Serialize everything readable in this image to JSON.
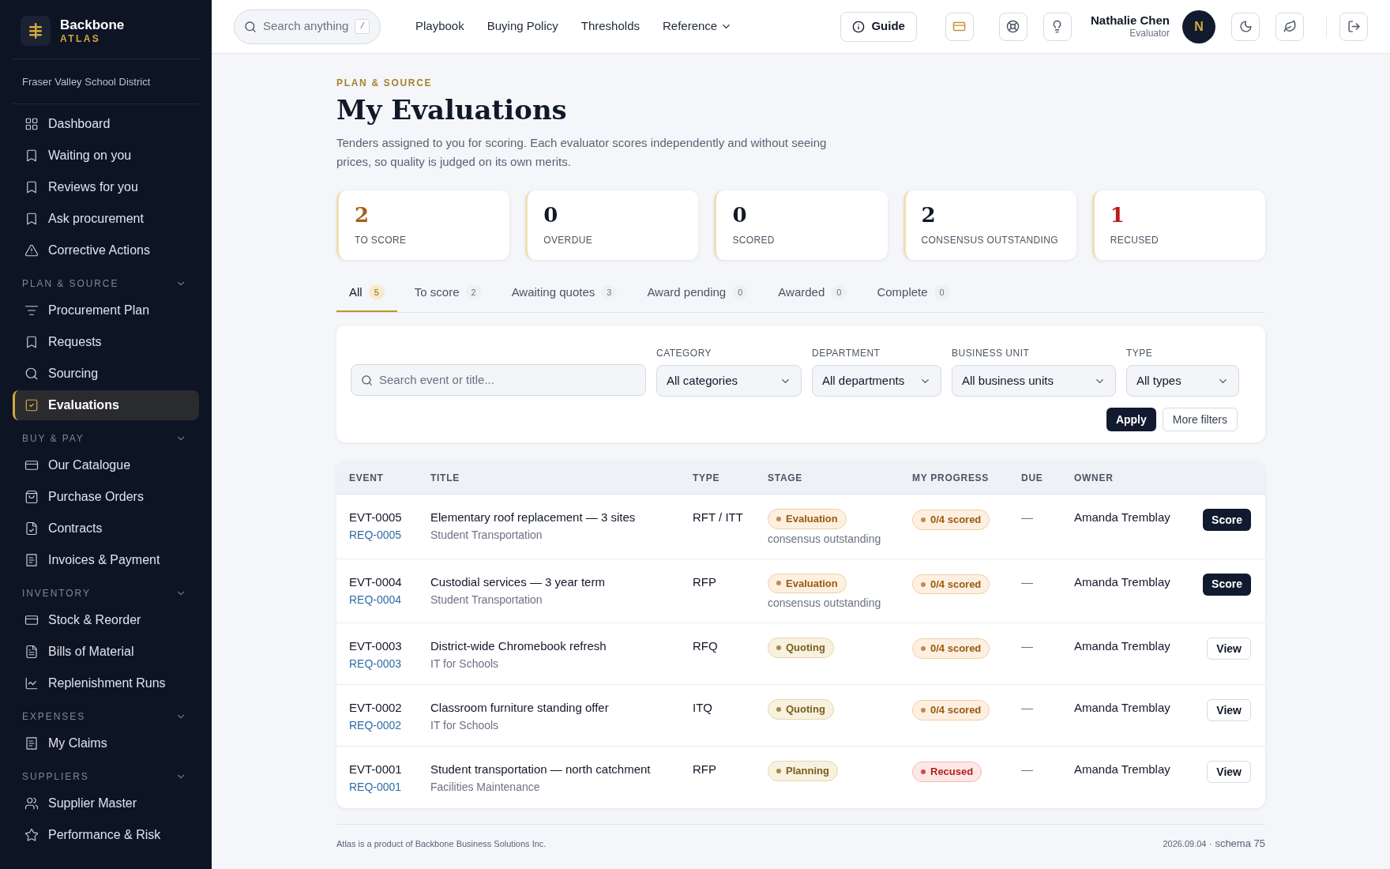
{
  "brand": {
    "name": "Backbone",
    "sub": "ATLAS",
    "org": "Fraser Valley School District"
  },
  "sidebar": {
    "items": [
      {
        "label": "Dashboard",
        "selected": false
      },
      {
        "label": "Waiting on you",
        "selected": false
      },
      {
        "label": "Reviews for you",
        "selected": false
      },
      {
        "label": "Ask procurement",
        "selected": false
      },
      {
        "label": "Corrective Actions",
        "selected": false
      }
    ],
    "sections": [
      {
        "title": "PLAN & SOURCE",
        "expanded": true,
        "items": [
          {
            "label": "Procurement Plan",
            "selected": false
          },
          {
            "label": "Requests",
            "selected": false
          },
          {
            "label": "Sourcing",
            "selected": false
          },
          {
            "label": "Evaluations",
            "selected": true
          }
        ]
      },
      {
        "title": "BUY & PAY",
        "expanded": true,
        "items": [
          {
            "label": "Our Catalogue",
            "selected": false
          },
          {
            "label": "Purchase Orders",
            "selected": false
          },
          {
            "label": "Contracts",
            "selected": false
          },
          {
            "label": "Invoices & Payment",
            "selected": false
          }
        ]
      },
      {
        "title": "INVENTORY",
        "expanded": true,
        "items": [
          {
            "label": "Stock & Reorder",
            "selected": false
          },
          {
            "label": "Bills of Material",
            "selected": false
          },
          {
            "label": "Replenishment Runs",
            "selected": false
          }
        ]
      },
      {
        "title": "EXPENSES",
        "expanded": true,
        "items": [
          {
            "label": "My Claims",
            "selected": false
          }
        ]
      },
      {
        "title": "SUPPLIERS",
        "expanded": true,
        "items": [
          {
            "label": "Supplier Master",
            "selected": false
          },
          {
            "label": "Performance & Risk",
            "selected": false
          }
        ]
      }
    ]
  },
  "topbar": {
    "search": {
      "placeholder": "Search anything",
      "shortcut": "/"
    },
    "links": [
      {
        "label": "Playbook",
        "has_menu": false
      },
      {
        "label": "Buying Policy",
        "has_menu": false
      },
      {
        "label": "Thresholds",
        "has_menu": false
      },
      {
        "label": "Reference",
        "has_menu": true
      }
    ],
    "guide": "Guide",
    "user": {
      "name": "Nathalie Chen",
      "role": "Evaluator",
      "initial": "N"
    }
  },
  "page": {
    "eyebrow": "PLAN & SOURCE",
    "title": "My Evaluations",
    "description": "Tenders assigned to you for scoring. Each evaluator scores independently and without seeing prices, so quality is judged on its own merits."
  },
  "stats": [
    {
      "value": "2",
      "label": "TO SCORE",
      "color": "#a85d1a"
    },
    {
      "value": "0",
      "label": "OVERDUE",
      "color": "#111827"
    },
    {
      "value": "0",
      "label": "SCORED",
      "color": "#111827"
    },
    {
      "value": "2",
      "label": "CONSENSUS OUTSTANDING",
      "color": "#111827"
    },
    {
      "value": "1",
      "label": "RECUSED",
      "color": "#b91c1c"
    }
  ],
  "tabs": [
    {
      "label": "All",
      "count": "5",
      "selected": true
    },
    {
      "label": "To score",
      "count": "2",
      "selected": false
    },
    {
      "label": "Awaiting quotes",
      "count": "3",
      "selected": false
    },
    {
      "label": "Award pending",
      "count": "0",
      "selected": false
    },
    {
      "label": "Awarded",
      "count": "0",
      "selected": false
    },
    {
      "label": "Complete",
      "count": "0",
      "selected": false
    }
  ],
  "filters": {
    "search": {
      "placeholder": "Search event or title..."
    },
    "selects": [
      {
        "label": "CATEGORY",
        "value": "All categories"
      },
      {
        "label": "DEPARTMENT",
        "value": "All departments"
      },
      {
        "label": "BUSINESS UNIT",
        "value": "All business units"
      },
      {
        "label": "TYPE",
        "value": "All types"
      }
    ],
    "apply": "Apply",
    "more": "More filters"
  },
  "table": {
    "columns": [
      "EVENT",
      "TITLE",
      "TYPE",
      "STAGE",
      "MY PROGRESS",
      "DUE",
      "OWNER"
    ],
    "rows": [
      {
        "event": "EVT-0005",
        "request": "REQ-0005",
        "title": "Elementary roof replacement — 3 sites",
        "department": "Student Transportation",
        "type": "RFT / ITT",
        "stage": {
          "label": "Evaluation",
          "kind": "active"
        },
        "stage_note": "consensus outstanding",
        "progress": {
          "label": "0/4 scored",
          "kind": "active"
        },
        "due": "—",
        "owner": "Amanda Tremblay",
        "action": {
          "label": "Score",
          "kind": "primary"
        }
      },
      {
        "event": "EVT-0004",
        "request": "REQ-0004",
        "title": "Custodial services — 3 year term",
        "department": "Student Transportation",
        "type": "RFP",
        "stage": {
          "label": "Evaluation",
          "kind": "active"
        },
        "stage_note": "consensus outstanding",
        "progress": {
          "label": "0/4 scored",
          "kind": "active"
        },
        "due": "—",
        "owner": "Amanda Tremblay",
        "action": {
          "label": "Score",
          "kind": "primary"
        }
      },
      {
        "event": "EVT-0003",
        "request": "REQ-0003",
        "title": "District-wide Chromebook refresh",
        "department": "IT for Schools",
        "type": "RFQ",
        "stage": {
          "label": "Quoting",
          "kind": "neutral"
        },
        "progress": {
          "label": "0/4 scored",
          "kind": "active"
        },
        "due": "—",
        "owner": "Amanda Tremblay",
        "action": {
          "label": "View",
          "kind": "secondary"
        }
      },
      {
        "event": "EVT-0002",
        "request": "REQ-0002",
        "title": "Classroom furniture standing offer",
        "department": "IT for Schools",
        "type": "ITQ",
        "stage": {
          "label": "Quoting",
          "kind": "neutral"
        },
        "progress": {
          "label": "0/4 scored",
          "kind": "active"
        },
        "due": "—",
        "owner": "Amanda Tremblay",
        "action": {
          "label": "View",
          "kind": "secondary"
        }
      },
      {
        "event": "EVT-0001",
        "request": "REQ-0001",
        "title": "Student transportation — north catchment",
        "department": "Facilities Maintenance",
        "type": "RFP",
        "stage": {
          "label": "Planning",
          "kind": "neutral"
        },
        "progress": {
          "label": "Recused",
          "kind": "danger"
        },
        "due": "—",
        "owner": "Amanda Tremblay",
        "action": {
          "label": "View",
          "kind": "secondary"
        }
      }
    ]
  },
  "footer": {
    "left": "Atlas is a product of Backbone Business Solutions Inc.",
    "date": "2026.09.04",
    "schema": "· schema 75"
  }
}
